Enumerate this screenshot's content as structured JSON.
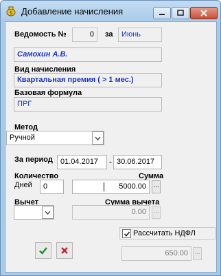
{
  "window": {
    "title": "Добавление начисления",
    "icon": "money-bag-icon"
  },
  "form": {
    "statement_label": "Ведомость №",
    "statement_number": "0",
    "month_label": "за",
    "month_value": "Июнь",
    "employee_name": "Самохин А.В.",
    "accrual_type_label": "Вид начисления",
    "accrual_type_value": "Квартальная премия ( > 1 мес.)",
    "base_formula_label": "Базовая формула",
    "base_formula_value": "ПРГ",
    "method_label": "Метод",
    "method_value": "Ручной",
    "period_label": "За период",
    "period_from": "01.04.2017",
    "period_dash": "-",
    "period_to": "30.06.2017",
    "quantity_label": "Количество",
    "days_label": "Дней",
    "days_value": "0",
    "amount_label": "Сумма",
    "amount_value": "5000.00",
    "deduction_label": "Вычет",
    "deduction_amount_label": "Сумма вычета",
    "deduction_amount_value": "0.00",
    "calc_ndfl_label": "Рассчитать НДФЛ",
    "calc_ndfl_checked": true,
    "ndfl_value": "650.00",
    "ellipsis": "..."
  },
  "colors": {
    "accent_blue_text": "#1c35c9",
    "ok_green": "#1f8c2a",
    "cancel_red": "#c8262a"
  }
}
